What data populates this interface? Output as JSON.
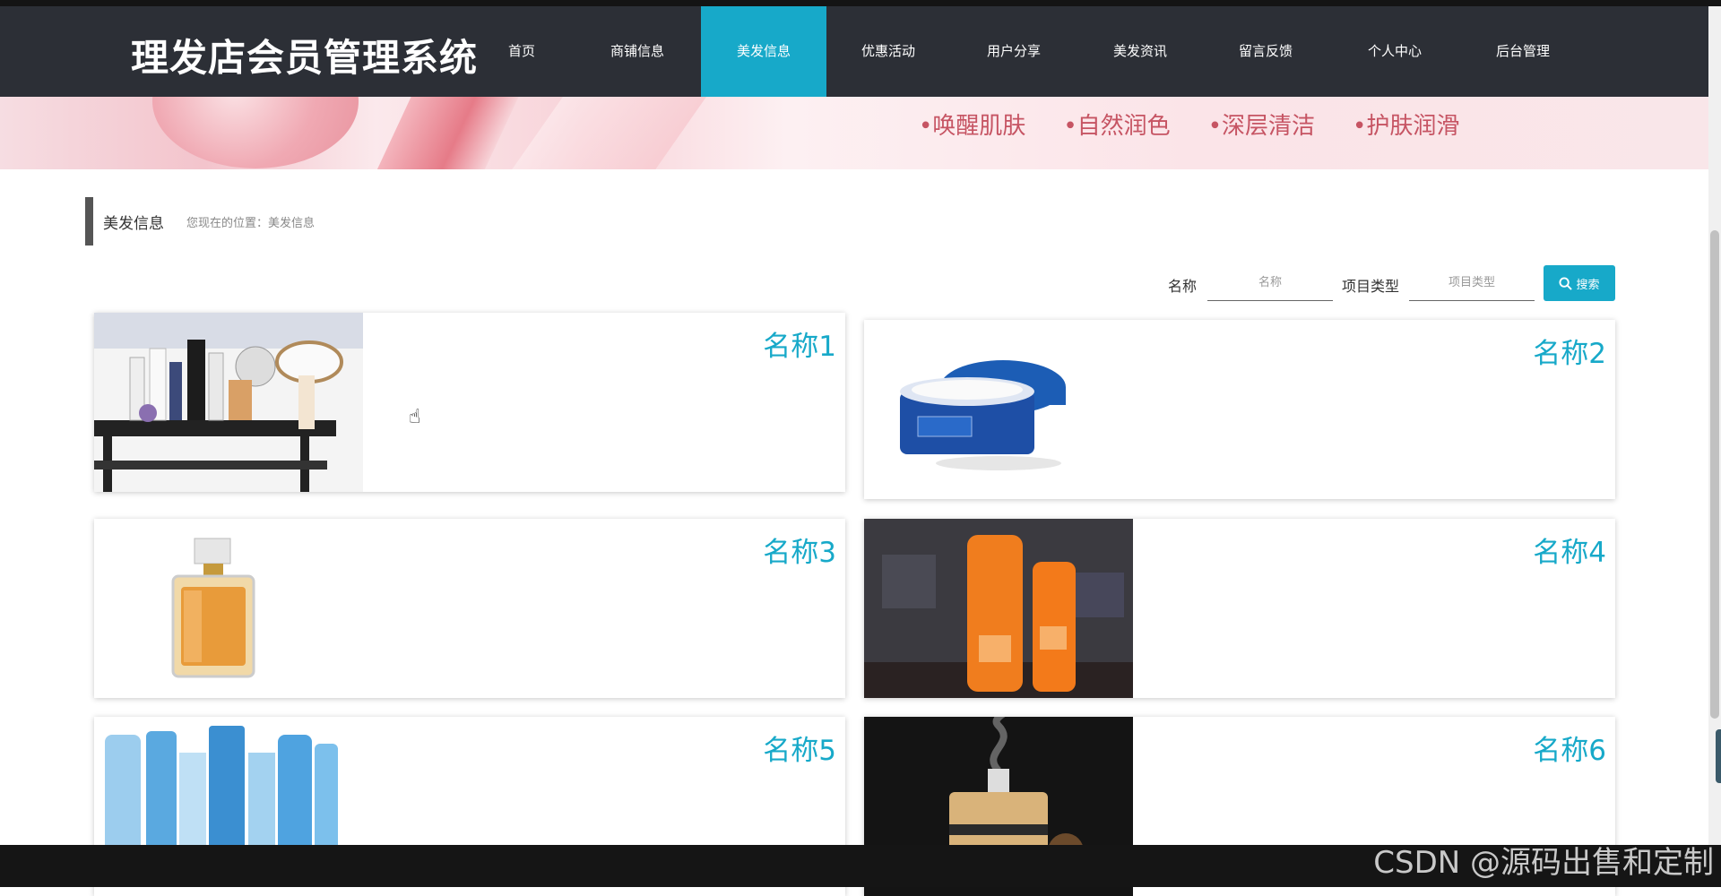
{
  "site": {
    "title": "理发店会员管理系统"
  },
  "nav": {
    "items": [
      {
        "label": "首页"
      },
      {
        "label": "商铺信息"
      },
      {
        "label": "美发信息"
      },
      {
        "label": "优惠活动"
      },
      {
        "label": "用户分享"
      },
      {
        "label": "美发资讯"
      },
      {
        "label": "留言反馈"
      },
      {
        "label": "个人中心"
      },
      {
        "label": "后台管理"
      }
    ],
    "active_index": 2
  },
  "banner": {
    "words": [
      "•唤醒肌肤",
      "•自然润色",
      "•深层清洁",
      "•护肤润滑"
    ]
  },
  "breadcrumb": {
    "title": "美发信息",
    "path": "您现在的位置：美发信息"
  },
  "search": {
    "name_label": "名称",
    "name_placeholder": "名称",
    "type_label": "项目类型",
    "type_placeholder": "项目类型",
    "button_label": "搜索"
  },
  "cards": [
    {
      "name": "名称1",
      "image": "salon-cosmetics-trolley"
    },
    {
      "name": "名称2",
      "image": "blue-cream-jar"
    },
    {
      "name": "名称3",
      "image": "perfume-bottle"
    },
    {
      "name": "名称4",
      "image": "orange-sunscreen-tubes"
    },
    {
      "name": "名称5",
      "image": "blue-skincare-set"
    },
    {
      "name": "名称6",
      "image": "aroma-diffuser"
    }
  ],
  "watermark": "CSDN @源码出售和定制",
  "colors": {
    "accent": "#17a9c9",
    "header_bg": "#2c2f36"
  }
}
